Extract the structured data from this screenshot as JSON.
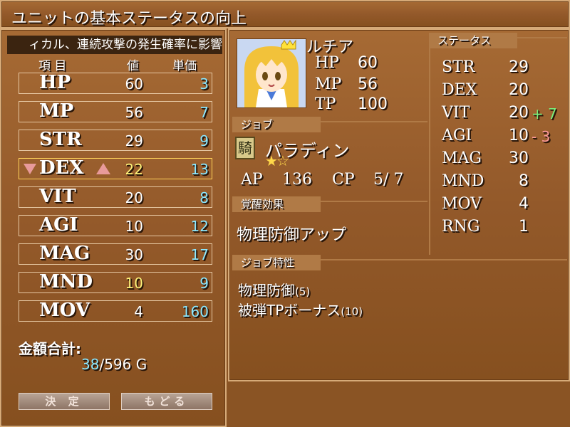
{
  "title": "ユニットの基本ステータスの向上",
  "help_text": "ィカル、連続攻撃の発生確率に影響",
  "table": {
    "headers": {
      "item": "項 目",
      "value": "値",
      "price": "単価"
    },
    "rows": [
      {
        "name": "HP",
        "value": "60",
        "price": "3"
      },
      {
        "name": "MP",
        "value": "56",
        "price": "7"
      },
      {
        "name": "STR",
        "value": "29",
        "price": "9"
      },
      {
        "name": "DEX",
        "value": "22",
        "price": "13"
      },
      {
        "name": "VIT",
        "value": "20",
        "price": "8"
      },
      {
        "name": "AGI",
        "value": "10",
        "price": "12"
      },
      {
        "name": "MAG",
        "value": "30",
        "price": "17"
      },
      {
        "name": "MND",
        "value": "10",
        "price": "9"
      },
      {
        "name": "MOV",
        "value": "4",
        "price": "160"
      }
    ]
  },
  "total": {
    "label": "金額合計:",
    "current": "38",
    "rest": "/596 G"
  },
  "buttons": {
    "confirm": "決 定",
    "back": "もどる"
  },
  "character": {
    "name": "ルチア",
    "stats": [
      {
        "label": "HP",
        "value": "60"
      },
      {
        "label": "MP",
        "value": "56"
      },
      {
        "label": "TP",
        "value": "100"
      }
    ]
  },
  "job": {
    "section": "ジョブ",
    "icon_char": "騎",
    "name": "パラディン",
    "stars": "★☆",
    "ap_label": "AP",
    "ap_value": "136",
    "cp_label": "CP",
    "cp_value": "5/ 7"
  },
  "awakening": {
    "section": "覚醒効果",
    "text": "物理防御アップ"
  },
  "traits": {
    "section": "ジョブ特性",
    "items": [
      {
        "name": "物理防御",
        "level": "(5)"
      },
      {
        "name": "被弾TPボーナス",
        "level": "(10)"
      }
    ]
  },
  "status": {
    "section": "ステータス",
    "rows": [
      {
        "name": "STR",
        "value": "29",
        "mod": ""
      },
      {
        "name": "DEX",
        "value": "20",
        "mod": ""
      },
      {
        "name": "VIT",
        "value": "20",
        "mod": "+ 7"
      },
      {
        "name": "AGI",
        "value": "10",
        "mod": "- 3"
      },
      {
        "name": "MAG",
        "value": "30",
        "mod": ""
      },
      {
        "name": "MND",
        "value": "8",
        "mod": ""
      },
      {
        "name": "MOV",
        "value": "4",
        "mod": ""
      },
      {
        "name": "RNG",
        "value": "1",
        "mod": ""
      }
    ]
  }
}
